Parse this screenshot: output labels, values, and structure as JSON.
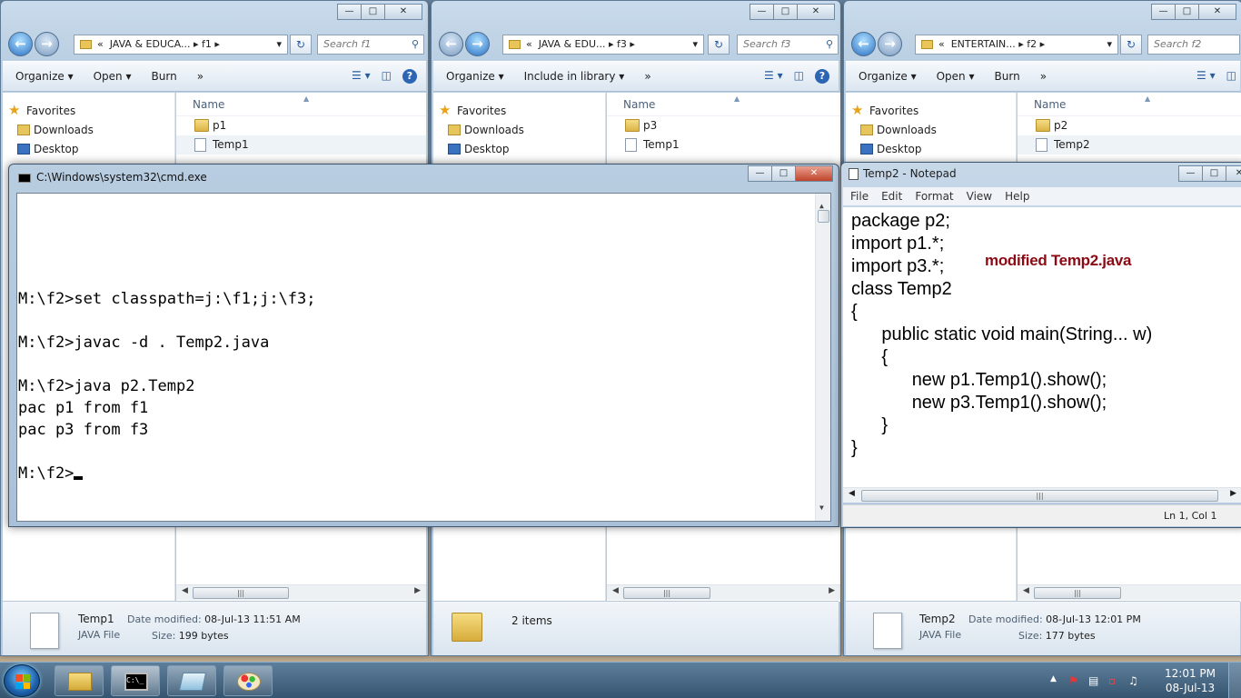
{
  "explorer1": {
    "path_prefix": "«",
    "path_a": "JAVA & EDUCA...",
    "path_b": "f1",
    "search_placeholder": "Search f1",
    "toolbar": [
      "Organize",
      "Open",
      "Burn",
      "»"
    ],
    "nav": {
      "favorites": "Favorites",
      "downloads": "Downloads",
      "desktop": "Desktop"
    },
    "column": "Name",
    "files": [
      {
        "name": "p1",
        "kind": "folder"
      },
      {
        "name": "Temp1",
        "kind": "file"
      }
    ],
    "details": {
      "name": "Temp1",
      "type": "JAVA File",
      "modified_label": "Date modified:",
      "modified": "08-Jul-13 11:51 AM",
      "size_label": "Size:",
      "size": "199 bytes"
    }
  },
  "explorer2": {
    "path_prefix": "«",
    "path_a": "JAVA & EDU...",
    "path_b": "f3",
    "search_placeholder": "Search f3",
    "toolbar": [
      "Organize",
      "Include in library",
      "»"
    ],
    "nav": {
      "favorites": "Favorites",
      "downloads": "Downloads",
      "desktop": "Desktop"
    },
    "column": "Name",
    "files": [
      {
        "name": "p3",
        "kind": "folder"
      },
      {
        "name": "Temp1",
        "kind": "file"
      }
    ],
    "details": {
      "items": "2 items"
    }
  },
  "explorer3": {
    "path_prefix": "«",
    "path_a": "ENTERTAIN...",
    "path_b": "f2",
    "search_placeholder": "Search f2",
    "toolbar": [
      "Organize",
      "Open",
      "Burn",
      "»"
    ],
    "nav": {
      "favorites": "Favorites",
      "downloads": "Downloads",
      "desktop": "Desktop"
    },
    "column": "Name",
    "files": [
      {
        "name": "p2",
        "kind": "folder"
      },
      {
        "name": "Temp2",
        "kind": "file"
      }
    ],
    "details": {
      "name": "Temp2",
      "type": "JAVA File",
      "modified_label": "Date modified:",
      "modified": "08-Jul-13 12:01 PM",
      "size_label": "Size:",
      "size": "177 bytes"
    }
  },
  "cmd": {
    "title": "C:\\Windows\\system32\\cmd.exe",
    "lines": [
      "",
      "M:\\f2>set classpath=j:\\f1;j:\\f3;",
      "",
      "M:\\f2>javac -d . Temp2.java",
      "",
      "M:\\f2>java p2.Temp2",
      "pac p1 from f1",
      "pac p3 from f3",
      "",
      "M:\\f2>"
    ]
  },
  "notepad": {
    "title": "Temp2 - Notepad",
    "menu": [
      "File",
      "Edit",
      "Format",
      "View",
      "Help"
    ],
    "code_lines": [
      "package p2;",
      "import p1.*;",
      "import p3.*;",
      "class Temp2",
      "{",
      "\t\tpublic static void main(String... w)",
      "\t\t{",
      "\t\t\t\tnew p1.Temp1().show();",
      "\t\t\t\tnew p3.Temp1().show();",
      "\t\t}",
      "}"
    ],
    "annotation": "modified Temp2.java",
    "status": "Ln 1, Col 1"
  },
  "taskbar": {
    "time": "12:01 PM",
    "date": "08-Jul-13"
  },
  "icons": {
    "caption": [
      "minimize-icon",
      "maximize-icon",
      "close-icon"
    ],
    "nav": [
      "back-arrow-icon",
      "forward-arrow-icon",
      "refresh-icon",
      "search-icon"
    ],
    "taskbar": [
      "windows-logo-icon",
      "explorer-icon",
      "cmd-icon",
      "notepad-icon",
      "paint-icon"
    ],
    "tray": [
      "show-hidden-icons",
      "flag-icon",
      "network-icon",
      "signal-icon",
      "volume-icon"
    ]
  },
  "colors": {
    "annotation": "#8b0a14",
    "console_bg": "#ffffff",
    "console_fg": "#000000"
  }
}
